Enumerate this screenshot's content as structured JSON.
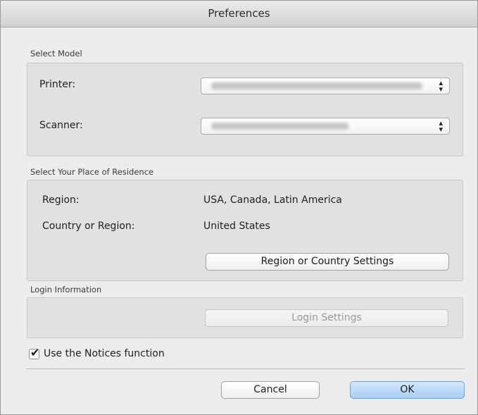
{
  "window": {
    "title": "Preferences"
  },
  "select_model": {
    "label": "Select Model",
    "printer_label": "Printer:",
    "scanner_label": "Scanner:"
  },
  "residence": {
    "label": "Select Your Place of Residence",
    "region_label": "Region:",
    "region_value": "USA, Canada, Latin America",
    "country_label": "Country or Region:",
    "country_value": "United States",
    "settings_button": "Region or Country Settings"
  },
  "login": {
    "label": "Login Information",
    "settings_button": "Login Settings"
  },
  "notices": {
    "checkbox_label": "Use the Notices function",
    "checked": true
  },
  "footer": {
    "cancel": "Cancel",
    "ok": "OK"
  },
  "icons": {
    "popup_arrows": "updown-arrows-icon",
    "checkmark": "checkmark-icon"
  },
  "colors": {
    "default_button": "#a6cdf5",
    "window_bg": "#ececec"
  }
}
